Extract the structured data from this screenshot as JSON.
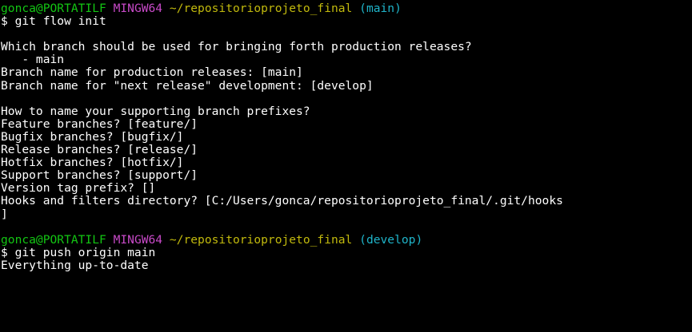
{
  "colors": {
    "background": "#000000",
    "text": "#ffffff",
    "user_host": "#13c613",
    "system": "#c84ac8",
    "path": "#c1b90d",
    "branch": "#1fb4c9"
  },
  "prompt1": {
    "user_host": "gonca@PORTATILF",
    "system": "MINGW64",
    "path": "~/repositorioprojeto_final",
    "branch": "(main)"
  },
  "command1": "$ git flow init",
  "output1": [
    "Which branch should be used for bringing forth production releases?",
    "   - main",
    "Branch name for production releases: [main]",
    "Branch name for \"next release\" development: [develop]"
  ],
  "output2": [
    "How to name your supporting branch prefixes?",
    "Feature branches? [feature/]",
    "Bugfix branches? [bugfix/]",
    "Release branches? [release/]",
    "Hotfix branches? [hotfix/]",
    "Support branches? [support/]",
    "Version tag prefix? []",
    "Hooks and filters directory? [C:/Users/gonca/repositorioprojeto_final/.git/hooks",
    "]"
  ],
  "prompt2": {
    "user_host": "gonca@PORTATILF",
    "system": "MINGW64",
    "path": "~/repositorioprojeto_final",
    "branch": "(develop)"
  },
  "command2": "$ git push origin main",
  "output3": [
    "Everything up-to-date"
  ]
}
